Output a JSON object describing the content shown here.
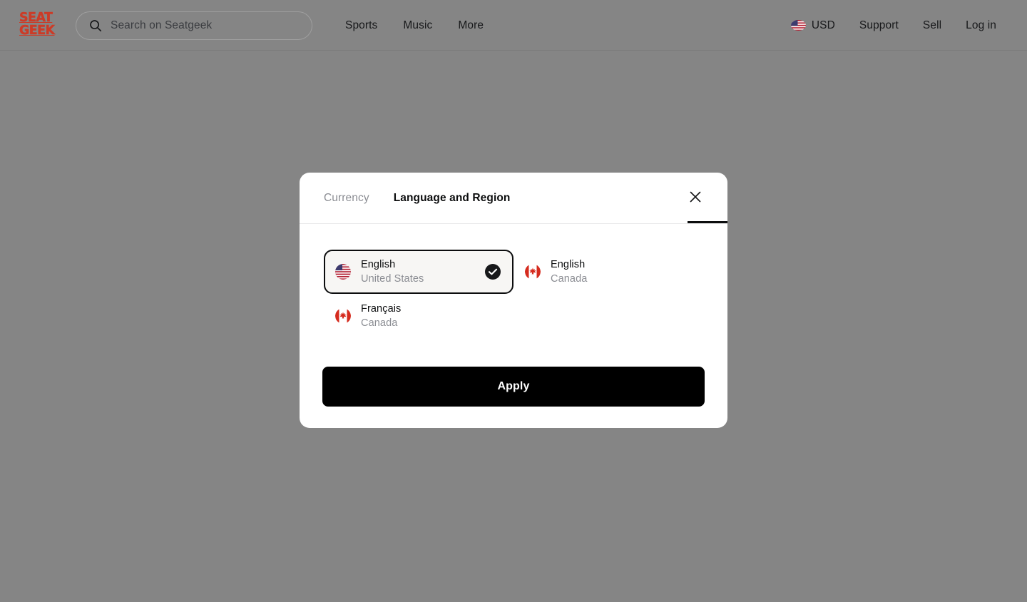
{
  "header": {
    "logo": {
      "line1": "SEAT",
      "line2": "GEEK",
      "color": "#cc3b27"
    },
    "search": {
      "placeholder": "Search on Seatgeek",
      "value": "",
      "icon": "search-icon"
    },
    "nav_left": [
      {
        "label": "Sports"
      },
      {
        "label": "Music"
      },
      {
        "label": "More"
      }
    ],
    "currency": {
      "label": "USD",
      "flag": "us-flag-icon"
    },
    "nav_right": [
      {
        "label": "Support"
      },
      {
        "label": "Sell"
      },
      {
        "label": "Log in"
      }
    ]
  },
  "modal": {
    "tabs": [
      {
        "label": "Currency",
        "active": false
      },
      {
        "label": "Language and Region",
        "active": true
      }
    ],
    "close_icon": "close-icon",
    "options": [
      {
        "language": "English",
        "region": "United States",
        "flag": "us-flag-icon",
        "selected": true
      },
      {
        "language": "English",
        "region": "Canada",
        "flag": "ca-flag-icon",
        "selected": false
      },
      {
        "language": "Français",
        "region": "Canada",
        "flag": "ca-flag-icon",
        "selected": false
      }
    ],
    "apply_label": "Apply"
  },
  "colors": {
    "backdrop": "#858585",
    "accent": "#cc3b27",
    "text_primary": "#0c0d0e",
    "text_muted": "#8b8d93",
    "selected_bg": "#f7f6f4",
    "button_bg": "#000000"
  }
}
